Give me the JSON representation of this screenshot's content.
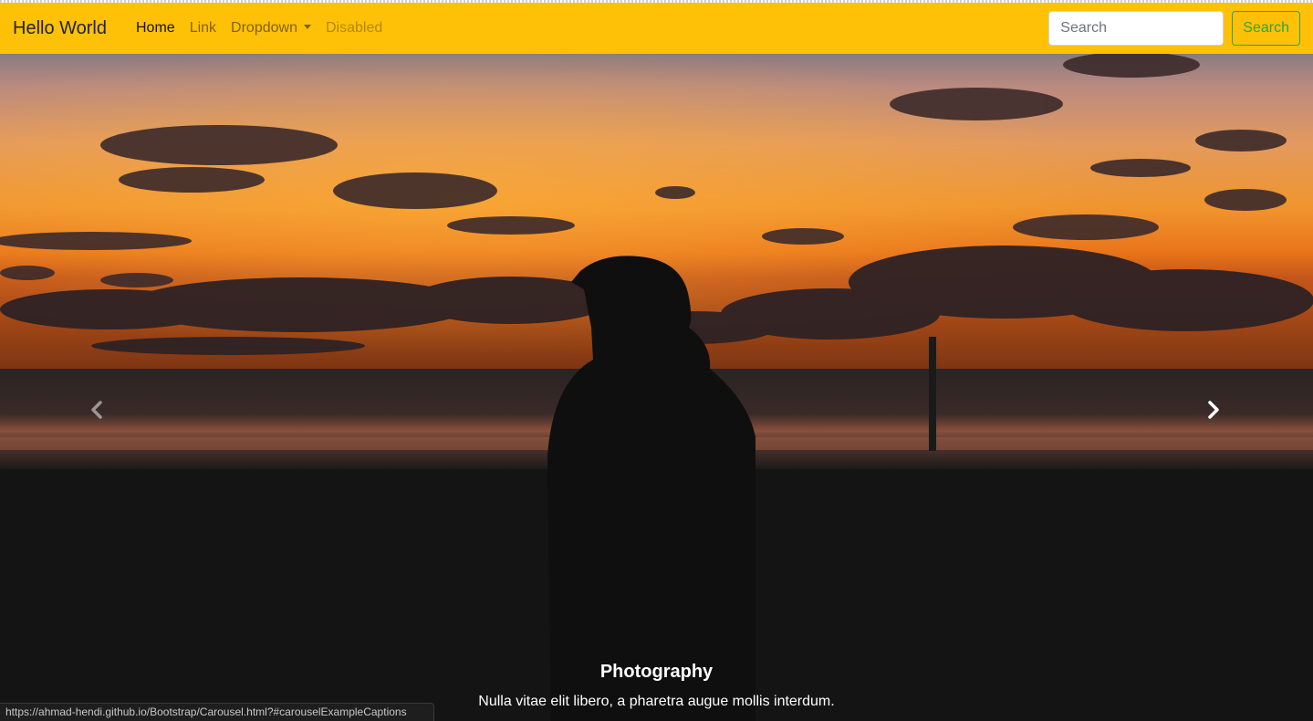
{
  "navbar": {
    "brand": "Hello World",
    "links": [
      {
        "label": "Home"
      },
      {
        "label": "Link"
      },
      {
        "label": "Dropdown"
      },
      {
        "label": "Disabled"
      }
    ],
    "search": {
      "placeholder": "Search",
      "button_label": "Search"
    },
    "colors": {
      "background": "#ffc107",
      "search_button": "#28a745"
    }
  },
  "carousel": {
    "caption_title": "Photography",
    "caption_text": "Nulla vitae elit libero, a pharetra augue mollis interdum.",
    "prev_icon": "chevron-left-icon",
    "next_icon": "chevron-right-icon"
  },
  "status_bar": {
    "url": "https://ahmad-hendi.github.io/Bootstrap/Carousel.html?#carouselExampleCaptions"
  }
}
